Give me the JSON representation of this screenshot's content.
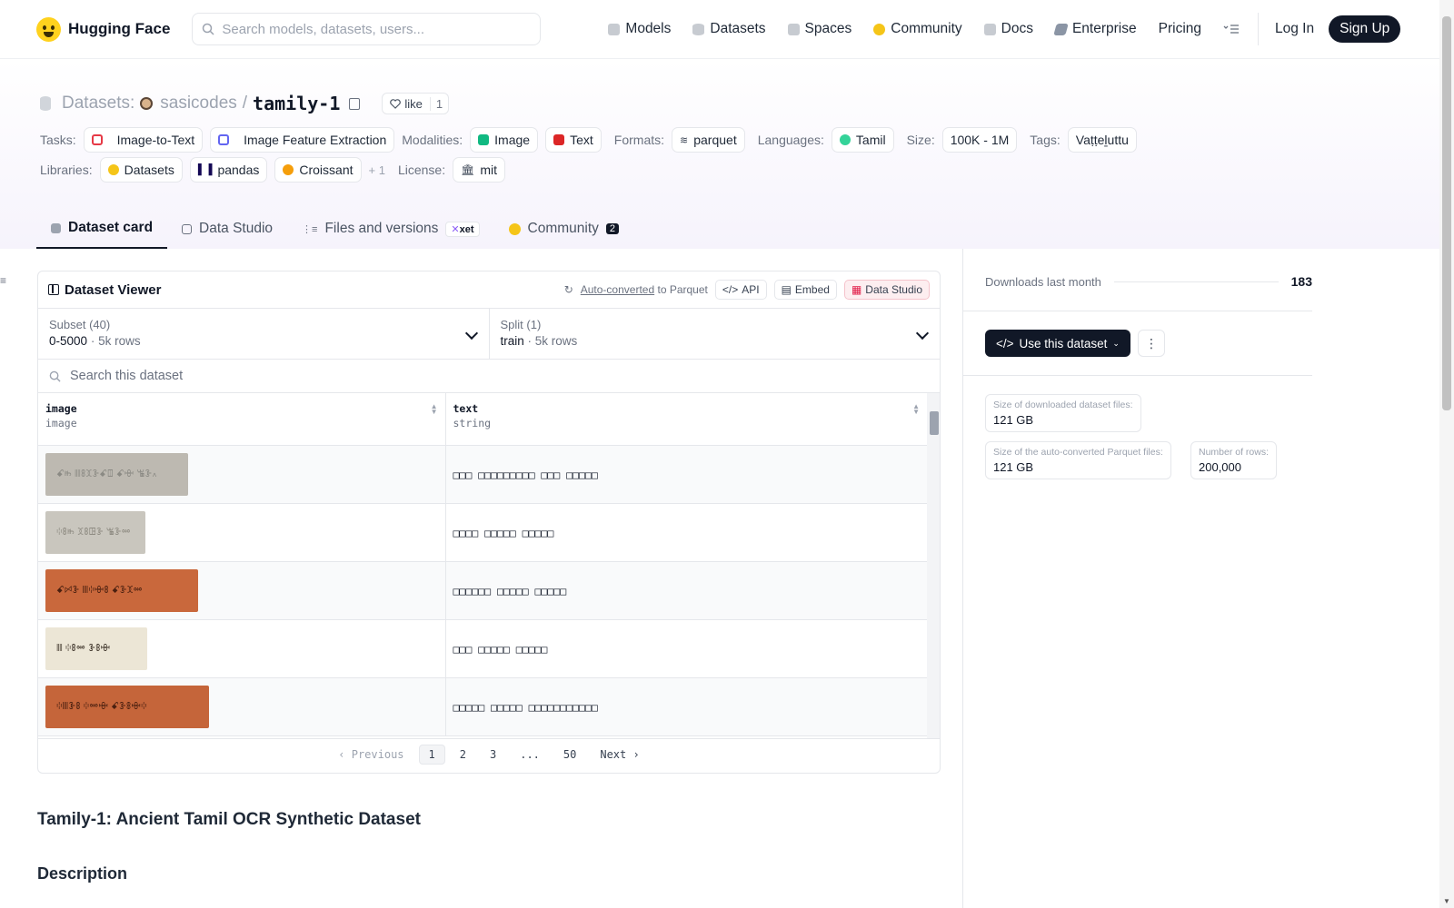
{
  "nav": {
    "logo": "Hugging Face",
    "search_placeholder": "Search models, datasets, users...",
    "items": [
      {
        "label": "Models",
        "icon": "cube-icon",
        "color": "#9ca3af"
      },
      {
        "label": "Datasets",
        "icon": "database-icon",
        "color": "#9ca3af"
      },
      {
        "label": "Spaces",
        "icon": "spaces-icon",
        "color": "#9ca3af"
      },
      {
        "label": "Community",
        "icon": "hf-community-icon",
        "color": "#f5c518"
      },
      {
        "label": "Docs",
        "icon": "book-icon",
        "color": "#9ca3af"
      },
      {
        "label": "Enterprise",
        "icon": "enterprise-icon",
        "color": "#9ca3af"
      },
      {
        "label": "Pricing",
        "icon": "",
        "color": ""
      }
    ],
    "login": "Log In",
    "signup": "Sign Up"
  },
  "header": {
    "section": "Datasets:",
    "owner": "sasicodes",
    "slash": "/",
    "repo": "tamily-1",
    "like_label": "like",
    "like_count": "1",
    "tasks_label": "Tasks:",
    "tasks": [
      "Image-to-Text",
      "Image Feature Extraction"
    ],
    "modalities_label": "Modalities:",
    "modalities": [
      "Image",
      "Text"
    ],
    "formats_label": "Formats:",
    "formats": [
      "parquet"
    ],
    "languages_label": "Languages:",
    "languages": [
      "Tamil"
    ],
    "size_label": "Size:",
    "size": "100K - 1M",
    "tags_label": "Tags:",
    "tags": [
      "Vaṭṭeḻuttu"
    ],
    "libraries_label": "Libraries:",
    "libraries": [
      "Datasets",
      "pandas",
      "Croissant"
    ],
    "libraries_more": "+ 1",
    "license_label": "License:",
    "license": "mit"
  },
  "tabs": [
    {
      "label": "Dataset card",
      "active": true
    },
    {
      "label": "Data Studio",
      "active": false
    },
    {
      "label": "Files and versions",
      "active": false,
      "badge": "xet"
    },
    {
      "label": "Community",
      "active": false,
      "count": "2"
    }
  ],
  "viewer": {
    "title": "Dataset Viewer",
    "auto_converted": "Auto-converted",
    "to_parquet": "to Parquet",
    "api": "API",
    "embed": "Embed",
    "data_studio": "Data Studio",
    "subset_label": "Subset (40)",
    "subset_value": "0-5000",
    "subset_rows": "5k rows",
    "split_label": "Split (1)",
    "split_value": "train",
    "split_rows": "5k rows",
    "search_placeholder": "Search this dataset",
    "columns": [
      {
        "name": "image",
        "type": "image"
      },
      {
        "name": "text",
        "type": "string"
      }
    ],
    "rows": [
      {
        "image_text": "ꗃꖰ ꘈꗚꘉꗿꗃꘖ ꗃꗳ ꘊꗿ꘍",
        "image_bg": "#bdb9b1",
        "image_fg": "#8b8a84",
        "image_w": 157,
        "text": "□□□ □□□□□□□□□ □□□ □□□□□"
      },
      {
        "image_text": "ꗺꗚꖰ ꘉꗚꖸꗿ ꘊꗿꗮ",
        "image_bg": "#c9c6be",
        "image_fg": "#8e8b82",
        "image_w": 110,
        "text": "□□□□ □□□□□ □□□□□"
      },
      {
        "image_text": "ꗃꗯꗿ ꘈꗺꗳꗚ ꗃꗿꘉꗮ",
        "image_bg": "#c9683c",
        "image_fg": "#4a2010",
        "image_w": 168,
        "text": "□□□□□□ □□□□□ □□□□□"
      },
      {
        "image_text": "ꘈ ꗺꗚꗮ ꗿꗚꗳ",
        "image_bg": "#ece6d6",
        "image_fg": "#3b3127",
        "image_w": 112,
        "text": "□□□ □□□□□ □□□□□"
      },
      {
        "image_text": "ꗺꘈꗿꗚ ꗺꗮꗳ ꗃꗿꗚꗳꗺ",
        "image_bg": "#c5653a",
        "image_fg": "#4a2010",
        "image_w": 180,
        "text": "□□□□□ □□□□□ □□□□□□□□□□□"
      }
    ],
    "pager": {
      "prev": "Previous",
      "pages": [
        "1",
        "2",
        "3",
        "...",
        "50"
      ],
      "current": "1",
      "next": "Next"
    }
  },
  "content": {
    "heading": "Tamily-1: Ancient Tamil OCR Synthetic Dataset",
    "subheading": "Description"
  },
  "sidebar": {
    "downloads_label": "Downloads last month",
    "downloads": "183",
    "use_dataset": "Use this dataset",
    "stats": [
      {
        "k": "Size of downloaded dataset files:",
        "v": "121 GB"
      },
      {
        "k": "Size of the auto-converted Parquet files:",
        "v": "121 GB"
      },
      {
        "k": "Number of rows:",
        "v": "200,000"
      }
    ]
  }
}
